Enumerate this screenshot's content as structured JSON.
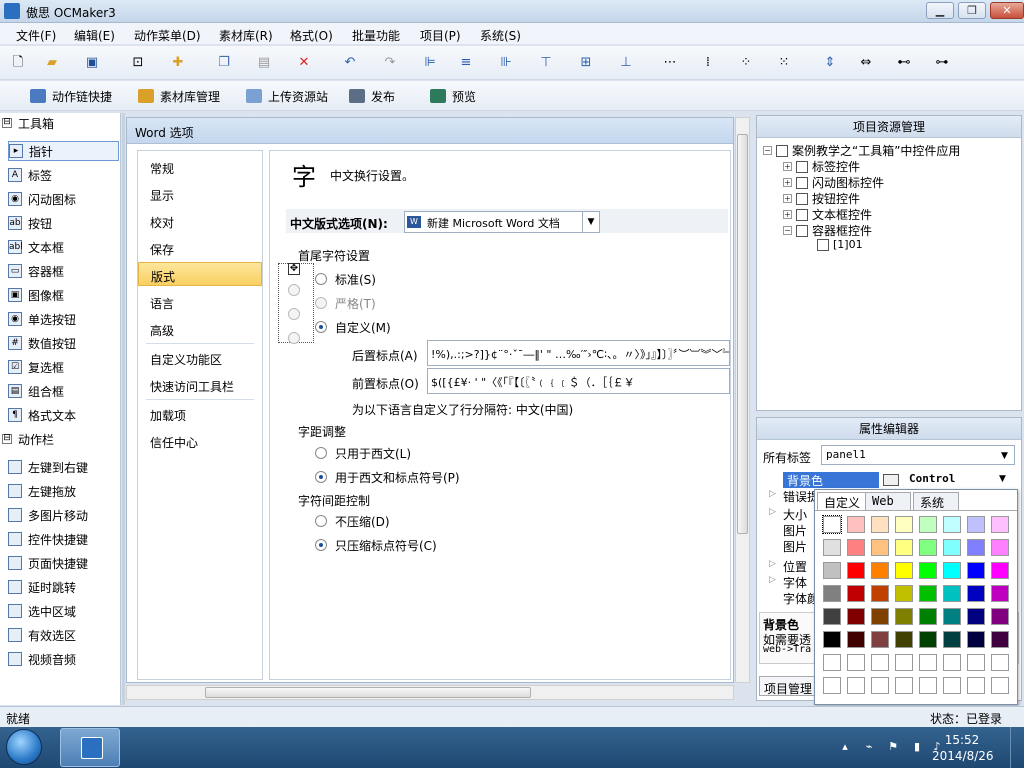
{
  "window": {
    "title": "傲思 OCMaker3",
    "min": "▁",
    "max": "❐",
    "close": "✕"
  },
  "menubar": [
    "文件(F)",
    "编辑(E)",
    "动作菜单(D)",
    "素材库(R)",
    "格式(O)",
    "批量功能",
    "项目(P)",
    "系统(S)"
  ],
  "toolbar1_icons": [
    "new-icon",
    "open-icon",
    "save-icon",
    "page-icon",
    "puzzle-icon",
    "copy-icon",
    "paste-icon",
    "delete-icon",
    "undo-icon",
    "redo-icon",
    "align-left-icon",
    "align-center-icon",
    "align-right-icon",
    "align-top-icon",
    "align-middle-icon",
    "align-bottom-icon",
    "h-distribute-icon",
    "h-equal-icon",
    "v-equal-icon",
    "v-distribute-icon",
    "center-h-icon",
    "center-v-icon",
    "same-width-icon",
    "same-height-icon"
  ],
  "toolbar2": [
    "动作链快捷",
    "素材库管理",
    "上传资源站",
    "发布",
    "预览"
  ],
  "toolbox": {
    "header1": "工具箱",
    "header1_box": "⊟",
    "tools": [
      "指针",
      "标签",
      "闪动图标",
      "按钮",
      "文本框",
      "容器框",
      "图像框",
      "单选按钮",
      "数值按钮",
      "复选框",
      "组合框",
      "格式文本"
    ],
    "tool_icons": [
      "▸",
      "A",
      "◉",
      "ab",
      "abl",
      "▭",
      "▣",
      "◉",
      "#",
      "☑",
      "▤",
      "¶"
    ],
    "header2": "动作栏",
    "header2_box": "⊟",
    "actions": [
      "左键到右键",
      "左键拖放",
      "多图片移动",
      "控件快捷键",
      "页面快捷键",
      "延时跳转",
      "选中区域",
      "有效选区",
      "视频音频"
    ]
  },
  "dialog": {
    "title": "Word 选项",
    "nav": [
      "常规",
      "显示",
      "校对",
      "保存",
      "版式",
      "语言",
      "高级",
      "自定义功能区",
      "快速访问工具栏",
      "加载项",
      "信任中心"
    ],
    "heading_glyph": "字",
    "heading": "中文换行设置。",
    "options_label": "中文版式选项(N):",
    "options_value": "新建 Microsoft Word 文档",
    "first_last_title": "首尾字符设置",
    "radio_standard": "标准(S)",
    "radio_strict": "严格(T)",
    "radio_custom": "自定义(M)",
    "following_label": "后置标点(A)",
    "following_value": "!%),.:;>?]}¢¨°·ˇˉ―‖' \" …‰′″›℃∶、。〃〉》」』】〕〗〞︶︺︾﹀﹄﹚﹜﹞！＂％＇），．：；？］｝～￠",
    "leading_label": "前置标点(O)",
    "leading_value": "$([{£¥· ' \"〈《「『【〔〖〝﹙﹛﹝＄（．［｛￡￥",
    "note": "为以下语言自定义了行分隔符: 中文(中国)",
    "kerning_title": "字距调整",
    "kerning_western": "只用于西文(L)",
    "kerning_both": "用于西文和标点符号(P)",
    "spacing_title": "字符间距控制",
    "spacing_none": "不压缩(D)",
    "spacing_punct": "只压缩标点符号(C)"
  },
  "project": {
    "title": "项目资源管理",
    "root": "案例教学之“工具箱”中控件应用",
    "nodes": [
      "标签控件",
      "闪动图标控件",
      "按钮控件",
      "文本框控件",
      "容器框控件"
    ],
    "leaf": "[1]01"
  },
  "properties": {
    "title": "属性编辑器",
    "all_tags_label": "所有标签",
    "selected_object": "panel1",
    "rows": [
      "背景色",
      "错误提",
      "大小",
      "图片",
      "图片",
      "位置",
      "字体",
      "字体颜"
    ],
    "bg_value": "Control",
    "desc_title": "背景色",
    "desc_line1": "如需要透",
    "desc_line2": "web->Tra",
    "bottom_tab": "项目管理"
  },
  "color_popup": {
    "tabs": [
      "自定义",
      "Web",
      "系统"
    ],
    "colors": [
      [
        "#ffffff",
        "#ffc0c0",
        "#ffe0c0",
        "#ffffc0",
        "#c0ffc0",
        "#c0ffff",
        "#c0c0ff",
        "#ffc0ff"
      ],
      [
        "#e0e0e0",
        "#ff8080",
        "#ffc080",
        "#ffff80",
        "#80ff80",
        "#80ffff",
        "#8080ff",
        "#ff80ff"
      ],
      [
        "#c0c0c0",
        "#ff0000",
        "#ff8000",
        "#ffff00",
        "#00ff00",
        "#00ffff",
        "#0000ff",
        "#ff00ff"
      ],
      [
        "#808080",
        "#c00000",
        "#c04000",
        "#c0c000",
        "#00c000",
        "#00c0c0",
        "#0000c0",
        "#c000c0"
      ],
      [
        "#404040",
        "#800000",
        "#804000",
        "#808000",
        "#008000",
        "#008080",
        "#000080",
        "#800080"
      ],
      [
        "#000000",
        "#400000",
        "#804040",
        "#404000",
        "#004000",
        "#004040",
        "#000040",
        "#400040"
      ],
      [
        "#ffffff",
        "#ffffff",
        "#ffffff",
        "#ffffff",
        "#ffffff",
        "#ffffff",
        "#ffffff",
        "#ffffff"
      ],
      [
        "#ffffff",
        "#ffffff",
        "#ffffff",
        "#ffffff",
        "#ffffff",
        "#ffffff",
        "#ffffff",
        "#ffffff"
      ]
    ]
  },
  "statusbar": {
    "left": "就绪",
    "right": "状态：已登录"
  },
  "taskbar": {
    "time": "15:52",
    "date": "2014/8/26"
  }
}
